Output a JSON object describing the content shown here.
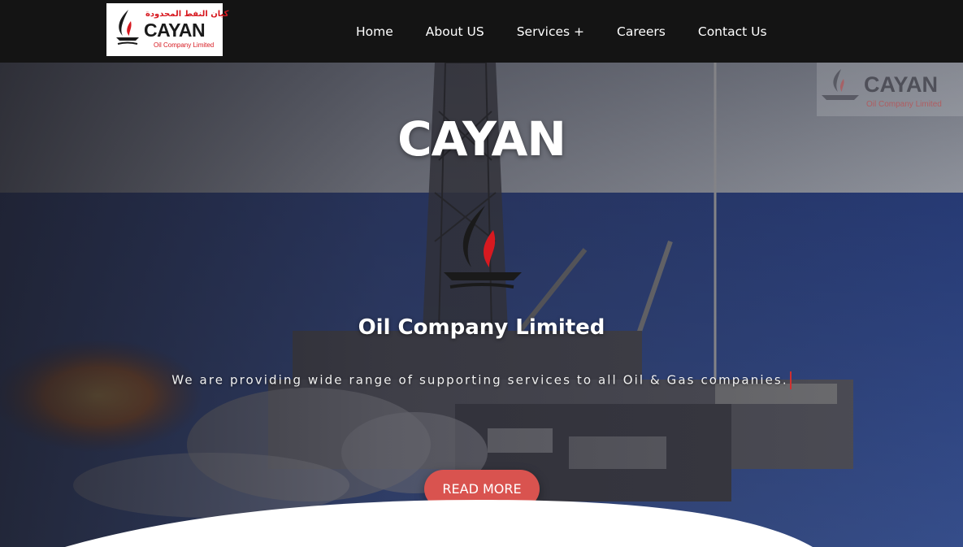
{
  "header": {
    "logo": {
      "arabic": "كيان النفط المحدودة",
      "name": "CAYAN",
      "subtitle": "Oil Company Limited"
    },
    "nav": [
      {
        "label": "Home"
      },
      {
        "label": "About US"
      },
      {
        "label": "Services +"
      },
      {
        "label": "Careers"
      },
      {
        "label": "Contact Us"
      }
    ]
  },
  "hero": {
    "watermark": {
      "name": "CAYAN",
      "subtitle": "Oil Company Limited"
    },
    "title": "CAYAN",
    "subtitle": "Oil Company Limited",
    "tagline": "We are providing wide range of supporting services to all Oil & Gas companies.",
    "cta_label": "READ MORE"
  },
  "colors": {
    "header_bg": "#141414",
    "accent": "#d9534f",
    "brand_red": "#d71920"
  },
  "icons": {
    "logo": "flame-drop-icon",
    "emblem": "flame-drop-icon"
  }
}
